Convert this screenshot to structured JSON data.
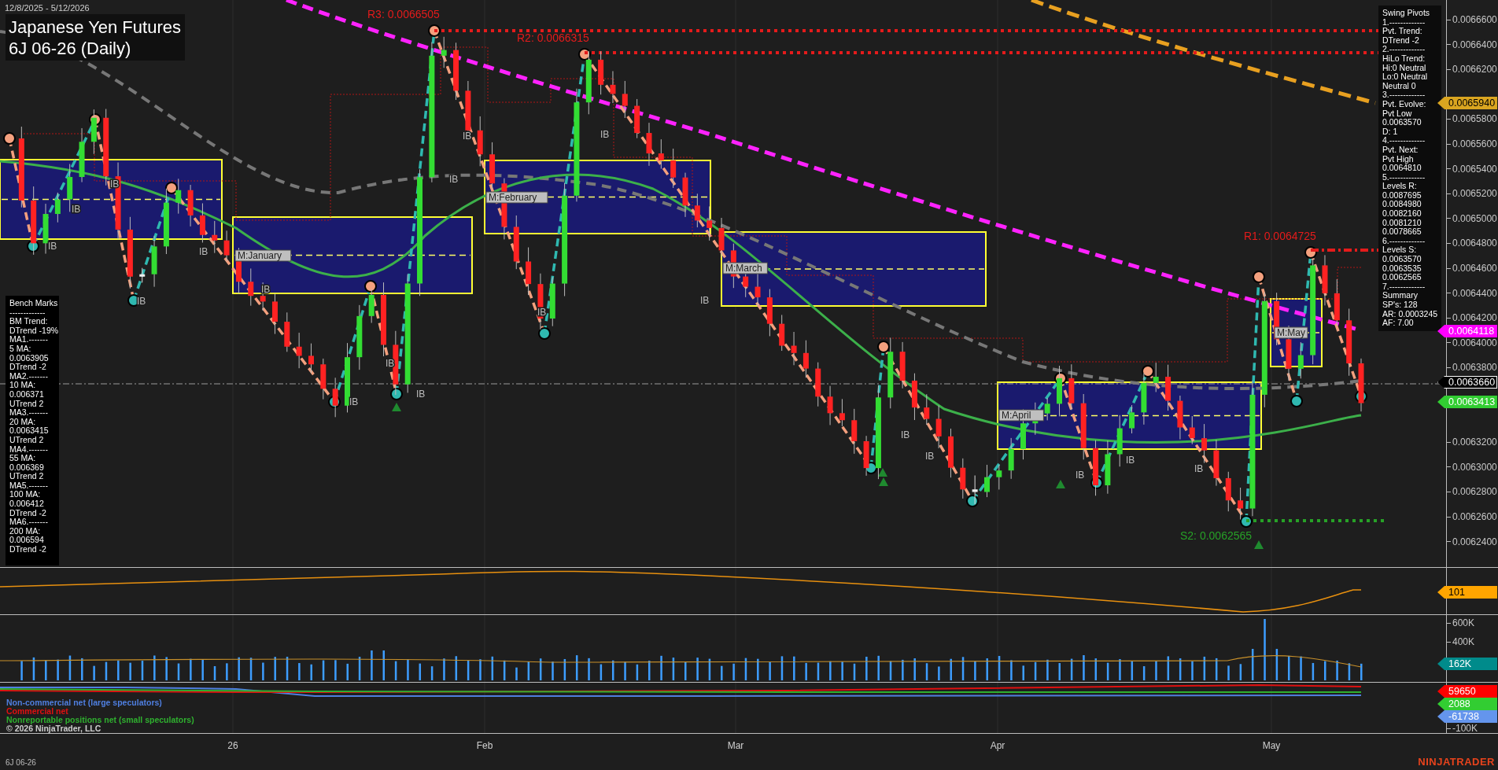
{
  "header": {
    "date_range": "12/8/2025 - 5/12/2026",
    "title": "Japanese Yen Futures",
    "subtitle": "6J 06-26 (Daily)"
  },
  "swing_pivots": {
    "lines": [
      "Swing Pivots",
      "1.-------------",
      "Pvt. Trend:",
      "DTrend -2",
      "2.-------------",
      "HiLo Trend:",
      "Hi:0 Neutral",
      "Lo:0 Neutral",
      "Neutral 0",
      "3.-------------",
      "Pvt. Evolve:",
      "Pvt Low",
      "0.0063570",
      "D: 1",
      "4.-------------",
      "Pvt. Next:",
      "Pvt High",
      "0.0064810",
      "5.-------------",
      "Levels R:",
      "0.0087695",
      "0.0084980",
      "0.0082160",
      "0.0081210",
      "0.0078665",
      "6.-------------",
      "Levels S:",
      "0.0063570",
      "0.0063535",
      "0.0062565",
      "7.-------------",
      "Summary",
      "SP's: 128",
      "AR: 0.0003245",
      "AF: 7.00"
    ]
  },
  "bench_marks": {
    "lines": [
      "Bench Marks",
      "-------------",
      "BM Trend:",
      "DTrend -19%",
      "MA1.-------",
      "5 MA:",
      "0.0063905",
      "DTrend -2",
      "MA2.-------",
      "10 MA:",
      "0.006371",
      "UTrend 2",
      "MA3.-------",
      "20 MA:",
      "0.0063415",
      "UTrend 2",
      "MA4.-------",
      "55 MA:",
      "0.006369",
      "UTrend 2",
      "MA5.-------",
      "100 MA:",
      "0.006412",
      "DTrend -2",
      "MA6.-------",
      "200 MA:",
      "0.006594",
      "DTrend -2"
    ]
  },
  "price_panel": {
    "level_labels": [
      {
        "text": "R3: 0.0066505",
        "kind": "resistance"
      },
      {
        "text": "R2: 0.0066315",
        "kind": "resistance"
      },
      {
        "text": "R1: 0.0064725",
        "kind": "resistance"
      },
      {
        "text": "S2: 0.0062565",
        "kind": "support"
      }
    ],
    "month_labels": [
      "M:January",
      "M:February",
      "M:March",
      "M:April",
      "M:May"
    ],
    "ib_labels": [
      "IB",
      "IB",
      "IB",
      "IB",
      "IB",
      "IB",
      "IB",
      "IB",
      "IB",
      "IB",
      "IB",
      "IB",
      "IB",
      "IB",
      "IB",
      "IB",
      "IB",
      "IB",
      "IB"
    ]
  },
  "price_axis": {
    "ticks": [
      "0.0066600",
      "0.0066400",
      "0.0066200",
      "0.0065800",
      "0.0065600",
      "0.0065400",
      "0.0065200",
      "0.0065000",
      "0.0064800",
      "0.0064600",
      "0.0064400",
      "0.0064200",
      "0.0064000",
      "0.0063800",
      "0.0063200",
      "0.0063000",
      "0.0062800",
      "0.0062600",
      "0.0062400"
    ],
    "tags": [
      {
        "value": "0.0065940",
        "color": "#daa520"
      },
      {
        "value": "0.0064118",
        "color": "#ff00ff"
      },
      {
        "value": "0.0063660",
        "color": "#000000"
      },
      {
        "value": "0.0063413",
        "color": "#32cd32"
      }
    ]
  },
  "indicator_axis": {
    "tags": [
      {
        "value": "101",
        "color": "#ffa500"
      }
    ]
  },
  "volume_axis": {
    "ticks": [
      "600K",
      "400K"
    ],
    "tags": [
      {
        "value": "162K",
        "color": "#008b8b"
      }
    ]
  },
  "cot_panel": {
    "legend": [
      {
        "label": "Non-commercial net (large speculators)",
        "color": "#4f7fe0"
      },
      {
        "label": "Commercial net",
        "color": "#e01010"
      },
      {
        "label": "Nonreportable positions net (small speculators)",
        "color": "#2fb02f"
      }
    ],
    "copyright": "© 2026 NinjaTrader, LLC"
  },
  "cot_axis": {
    "ticks": [
      "-100K"
    ],
    "tags": [
      {
        "value": "59650",
        "color": "#ff0000"
      },
      {
        "value": "2088",
        "color": "#32cd32"
      },
      {
        "value": "-61738",
        "color": "#6495ed"
      }
    ]
  },
  "x_axis": {
    "labels": [
      "26",
      "Feb",
      "Mar",
      "Apr",
      "May"
    ]
  },
  "footer": {
    "symbol": "6J 06-26",
    "logo": "NINJATRADER"
  }
}
